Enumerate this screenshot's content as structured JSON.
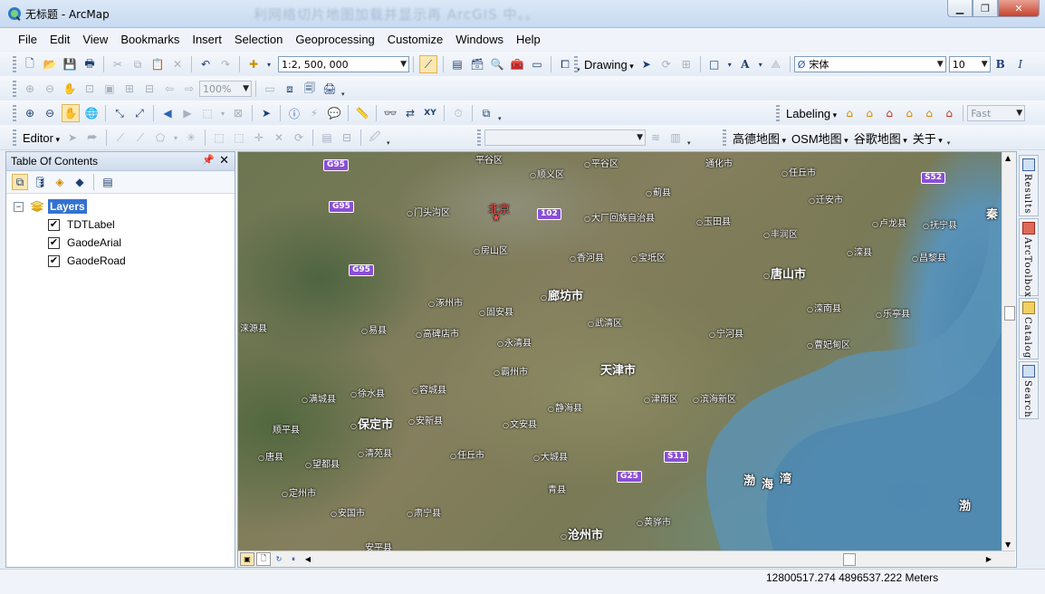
{
  "window": {
    "title": "无标题 - ArcMap",
    "blurred_caption": "利网络切片地图加载并显示再 ArcGIS 中。。",
    "controls": [
      "minimize",
      "maximize",
      "close"
    ]
  },
  "menu": [
    "File",
    "Edit",
    "View",
    "Bookmarks",
    "Insert",
    "Selection",
    "Geoprocessing",
    "Customize",
    "Windows",
    "Help"
  ],
  "standard_toolbar": {
    "scale": "1:2, 500, 000"
  },
  "drawing_toolbar": {
    "label": "Drawing",
    "font": "宋体",
    "font_size": "10",
    "bold": "B",
    "italic": "I",
    "text_tool": "A"
  },
  "layout_toolbar": {
    "zoom": "100%"
  },
  "labeling_toolbar": {
    "label": "Labeling",
    "mode": "Fast"
  },
  "editor_toolbar": {
    "label": "Editor"
  },
  "tile_toolbar": {
    "items": [
      "高德地图",
      "OSM地图",
      "谷歌地图",
      "关于"
    ]
  },
  "toc": {
    "title": "Table Of Contents",
    "root": "Layers",
    "layers": [
      {
        "name": "TDTLabel",
        "checked": true
      },
      {
        "name": "GaodeArial",
        "checked": true
      },
      {
        "name": "GaodeRoad",
        "checked": true
      }
    ]
  },
  "map_labels": {
    "beijing": "北京",
    "tianjin": "天津市",
    "tangshan": "唐山市",
    "langfang": "廊坊市",
    "baoding": "保定市",
    "cangzhou": "沧州市",
    "shunyi": "顺义区",
    "pinggu": "平谷区",
    "tongzhou_top": "通化市",
    "renqiu": "任丘市",
    "jixian": "蓟县",
    "yutian": "玉田县",
    "fengrun": "丰润区",
    "qianan": "迁安市",
    "lulong": "卢龙县",
    "funing": "抚宁县",
    "qin": "秦",
    "luanxian": "滦县",
    "changli": "昌黎县",
    "luannan": "滦南县",
    "laoting": "乐亭县",
    "caofeidian": "曹妃甸区",
    "ninghe": "宁河县",
    "baodi": "宝坻区",
    "xianghe": "香河县",
    "dachang": "大厂回族自治县",
    "wuqing": "武清区",
    "guan": "固安县",
    "zhuozhou": "涿州市",
    "fangshan": "房山区",
    "mentougou": "门头沟区",
    "laiyuan": "涞源县",
    "yixian": "易县",
    "gaobeidian": "高碑店市",
    "yongqing": "永清县",
    "bazhou": "霸州市",
    "xushui": "徐水县",
    "rongcheng": "容城县",
    "mancheng": "满城县",
    "anxin": "安新县",
    "wenan": "文安县",
    "jinghai": "静海县",
    "jinnan": "津南区",
    "binhai": "滨海新区",
    "daxing_county": "大城县",
    "qingxian": "青县",
    "huanghua": "黄骅市",
    "shunping": "顺平县",
    "tangxian": "唐县",
    "wangdu": "望都县",
    "qingyuan": "清苑县",
    "dingzhou": "定州市",
    "anguo": "安国市",
    "suning": "肃宁县",
    "anping": "安平县",
    "bo": "渤",
    "hai": "海",
    "wan": "湾",
    "bo2": "渤",
    "xiangfu": "平谷区",
    "wuqiang": "任丘市"
  },
  "road_shields": [
    "G95",
    "G95",
    "G95",
    "S52",
    "S11",
    "G25",
    "102"
  ],
  "dock_tabs": [
    "Results",
    "ArcToolbox",
    "Catalog",
    "Search"
  ],
  "status": {
    "coords": "12800517.274  4896537.222 Meters"
  },
  "colors": {
    "accent": "#3372d0",
    "title_bar": "#c7daf1",
    "selection": "#fbe7b0",
    "road_shield": "#8a4fd6"
  }
}
